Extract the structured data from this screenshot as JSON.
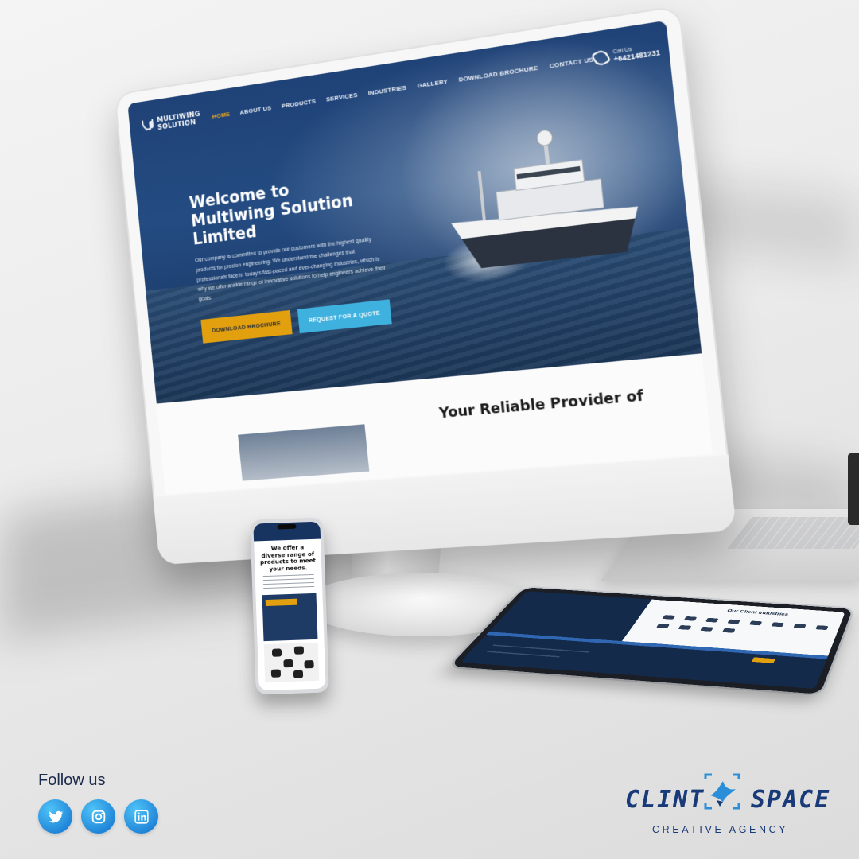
{
  "website": {
    "logo_text": "MULTIWING SOLUTION",
    "nav": {
      "items": [
        {
          "label": "HOME",
          "active": true
        },
        {
          "label": "ABOUT US"
        },
        {
          "label": "PRODUCTS"
        },
        {
          "label": "SERVICES"
        },
        {
          "label": "INDUSTRIES"
        },
        {
          "label": "GALLERY"
        },
        {
          "label": "DOWNLOAD BROCHURE"
        },
        {
          "label": "CONTACT US"
        }
      ],
      "call_label": "Call Us",
      "call_number": "+6421481231"
    },
    "hero": {
      "title_line1": "Welcome to",
      "title_line2": "Multiwing Solution Limited",
      "description": "Our company is committed to provide our customers with the highest quality products for precion engineering. We understand the challenges that professionals face in today's fast-paced and ever-changing industries, which is why we offer a wide range of innovative solutions to help engineers achieve their goals.",
      "btn_brochure": "DOWNLOAD BROCHURE",
      "btn_quote": "REQUEST FOR A QUOTE"
    },
    "below_heading": "Your Reliable Provider of"
  },
  "phone_screen": {
    "heading": "We offer a diverse range of products to meet your needs."
  },
  "tablet_screen": {
    "title": "Our Client Industries"
  },
  "footer": {
    "follow_label": "Follow us",
    "social_icons": [
      "twitter-icon",
      "instagram-icon",
      "linkedin-icon"
    ],
    "brand_word1": "CLINT",
    "brand_word2": "SPACE",
    "brand_tagline": "CREATIVE AGENCY"
  },
  "colors": {
    "navy": "#193a78",
    "accent_orange": "#e2a00f",
    "accent_cyan": "#3fb1df",
    "social_blue": "#1b7fd6"
  }
}
